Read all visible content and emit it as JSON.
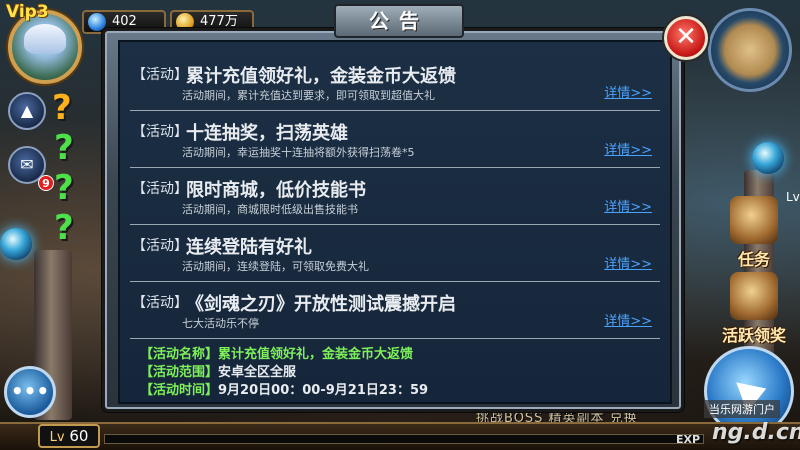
{
  "player": {
    "vip_label": "Vip3",
    "gems": "402",
    "gold": "477万",
    "level_prefix": "Lv",
    "level": "60",
    "mail_badge": "9"
  },
  "hud": {
    "up_arrow": "▲",
    "mail_icon": "✉",
    "chat_icon": "•••",
    "quest_marks": [
      "?",
      "?",
      "?",
      "?"
    ],
    "right_level": "Lv",
    "task_label": "任务",
    "activity_label": "活跃领奖",
    "exp_label": "EXP",
    "bottom_hint": "挑战BOSS  精英副本  兑换"
  },
  "dialog": {
    "title": "公告",
    "close_icon": "✕",
    "items": [
      {
        "tag": "【活动】",
        "title": "累计充值领好礼，金装金币大返馈",
        "desc": "活动期间，累计充值达到要求，即可领取到超值大礼",
        "detail": "详情>>"
      },
      {
        "tag": "【活动】",
        "title": "十连抽奖，扫荡英雄",
        "desc": "活动期间，幸运抽奖十连抽将额外获得扫荡卷*5",
        "detail": "详情>>"
      },
      {
        "tag": "【活动】",
        "title": "限时商城，低价技能书",
        "desc": "活动期间，商城限时低级出售技能书",
        "detail": "详情>>"
      },
      {
        "tag": "【活动】",
        "title": "连续登陆有好礼",
        "desc": "活动期间，连续登陆，可领取免费大礼",
        "detail": "详情>>"
      },
      {
        "tag": "【活动】",
        "title": "《剑魂之刃》开放性测试震撼开启",
        "desc": "七大活动乐不停",
        "detail": "详情>>"
      }
    ],
    "detail_section": {
      "name_key": "【活动名称】",
      "name_value": "累计充值领好礼，金装金币大返馈",
      "range_key": "【活动范围】",
      "range_value": "安卓全区全服",
      "time_key": "【活动时间】",
      "time_value": "9月20日00：00-9月21日23：59"
    }
  },
  "watermark": {
    "small": "当乐网游门户",
    "big": "ng.d.cn"
  },
  "colors": {
    "detail_link": "#4aa2ff",
    "highlight_green": "#7df05a",
    "vip_gold": "#ffe44a",
    "close_red": "#c81818"
  }
}
